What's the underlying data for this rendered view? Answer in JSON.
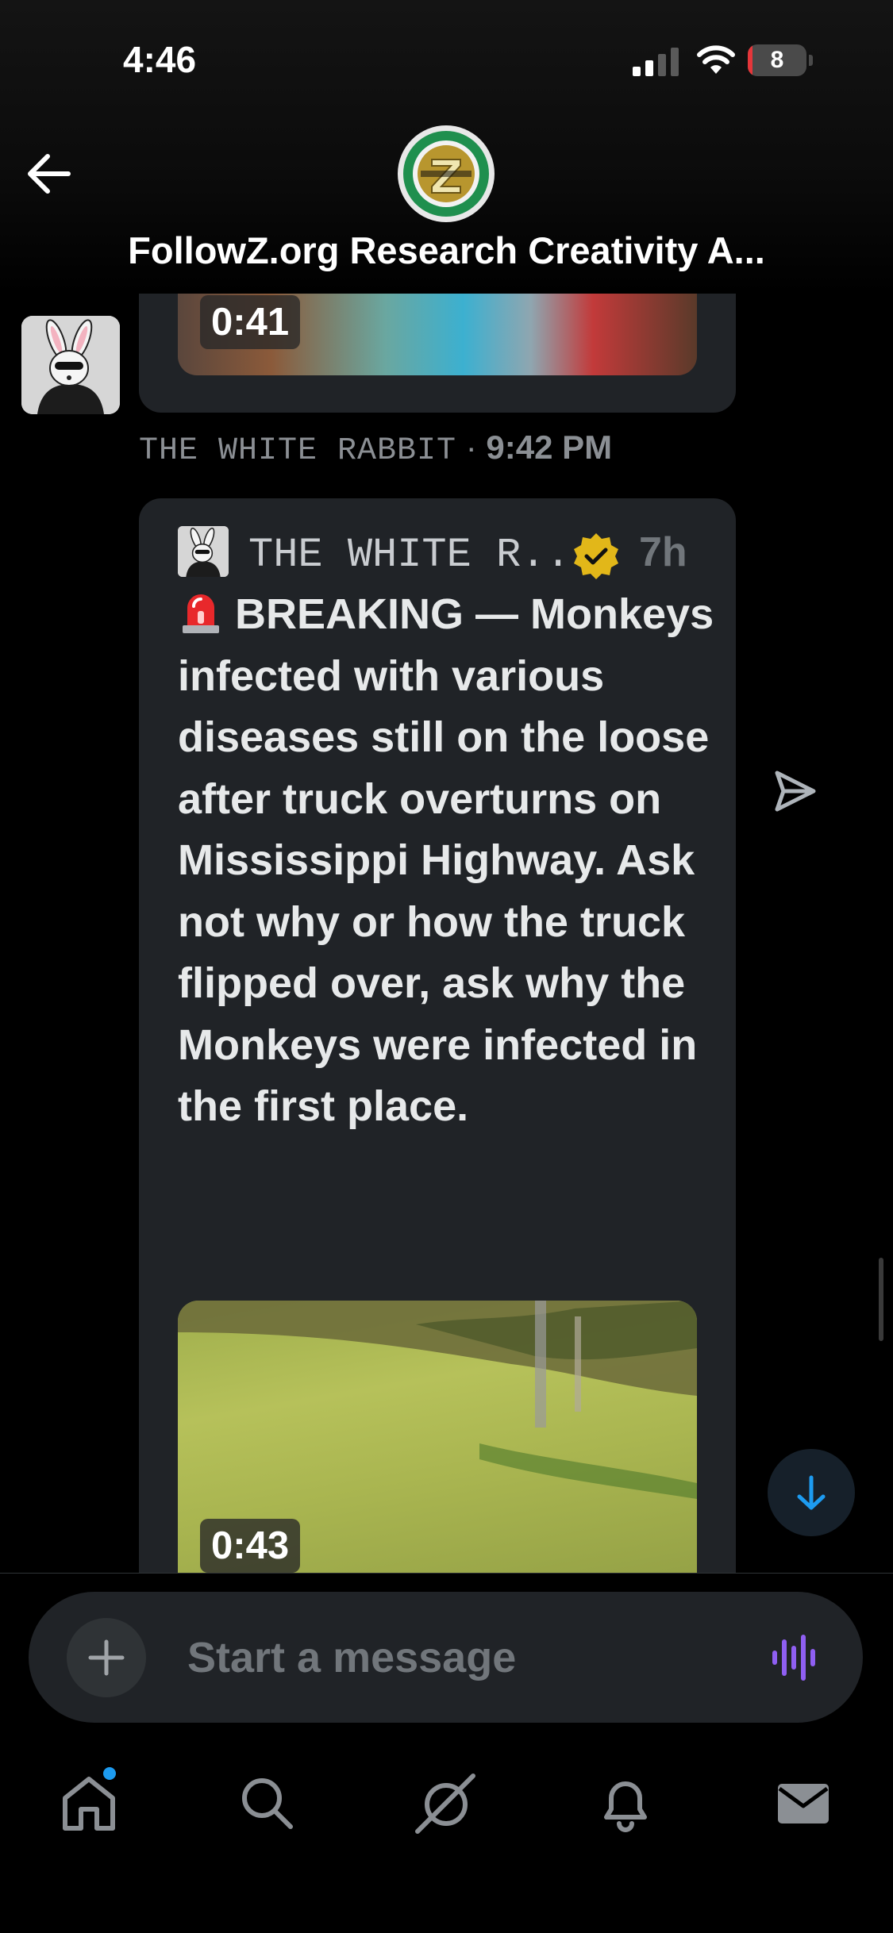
{
  "status_bar": {
    "time": "4:46",
    "battery_level": "8",
    "battery_color": "#e5363a",
    "signal_icon": "cellular-signal-icon",
    "wifi_icon": "wifi-icon"
  },
  "header": {
    "title": "FollowZ.org Research Creativity A...",
    "back_icon": "arrow-left-icon",
    "avatar_icon": "group-logo-z"
  },
  "messages": {
    "previous": {
      "video_duration": "0:41",
      "sender_name": "THE WHITE RABBIT",
      "separator": "·",
      "sent_time": "9:42 PM"
    },
    "current": {
      "quoted_author": "THE WHITE R...",
      "verified_icon": "gold-verified-badge-icon",
      "age": "7h",
      "siren_icon": "police-siren-emoji",
      "text": "BREAKING — Monkeys infected with various diseases still on the loose after truck overturns on Mississippi Highway. Ask not why or how the truck flipped over, ask why the Monkeys were infected in the first place.",
      "video_duration": "0:43"
    }
  },
  "composer": {
    "placeholder": "Start a message",
    "add_icon": "plus-icon",
    "voice_icon": "voice-wave-icon",
    "accent_color": "#8f5ff2"
  },
  "tabs": [
    {
      "name": "home",
      "icon": "home-icon",
      "has_notification_dot": true
    },
    {
      "name": "search",
      "icon": "search-icon"
    },
    {
      "name": "grok",
      "icon": "grok-icon"
    },
    {
      "name": "notifications",
      "icon": "bell-icon"
    },
    {
      "name": "messages",
      "icon": "mail-icon"
    }
  ],
  "colors": {
    "background": "#000000",
    "bubble": "#202327",
    "text": "#e7e9ea",
    "muted": "#71767b",
    "link_blue": "#1d9bf0"
  }
}
